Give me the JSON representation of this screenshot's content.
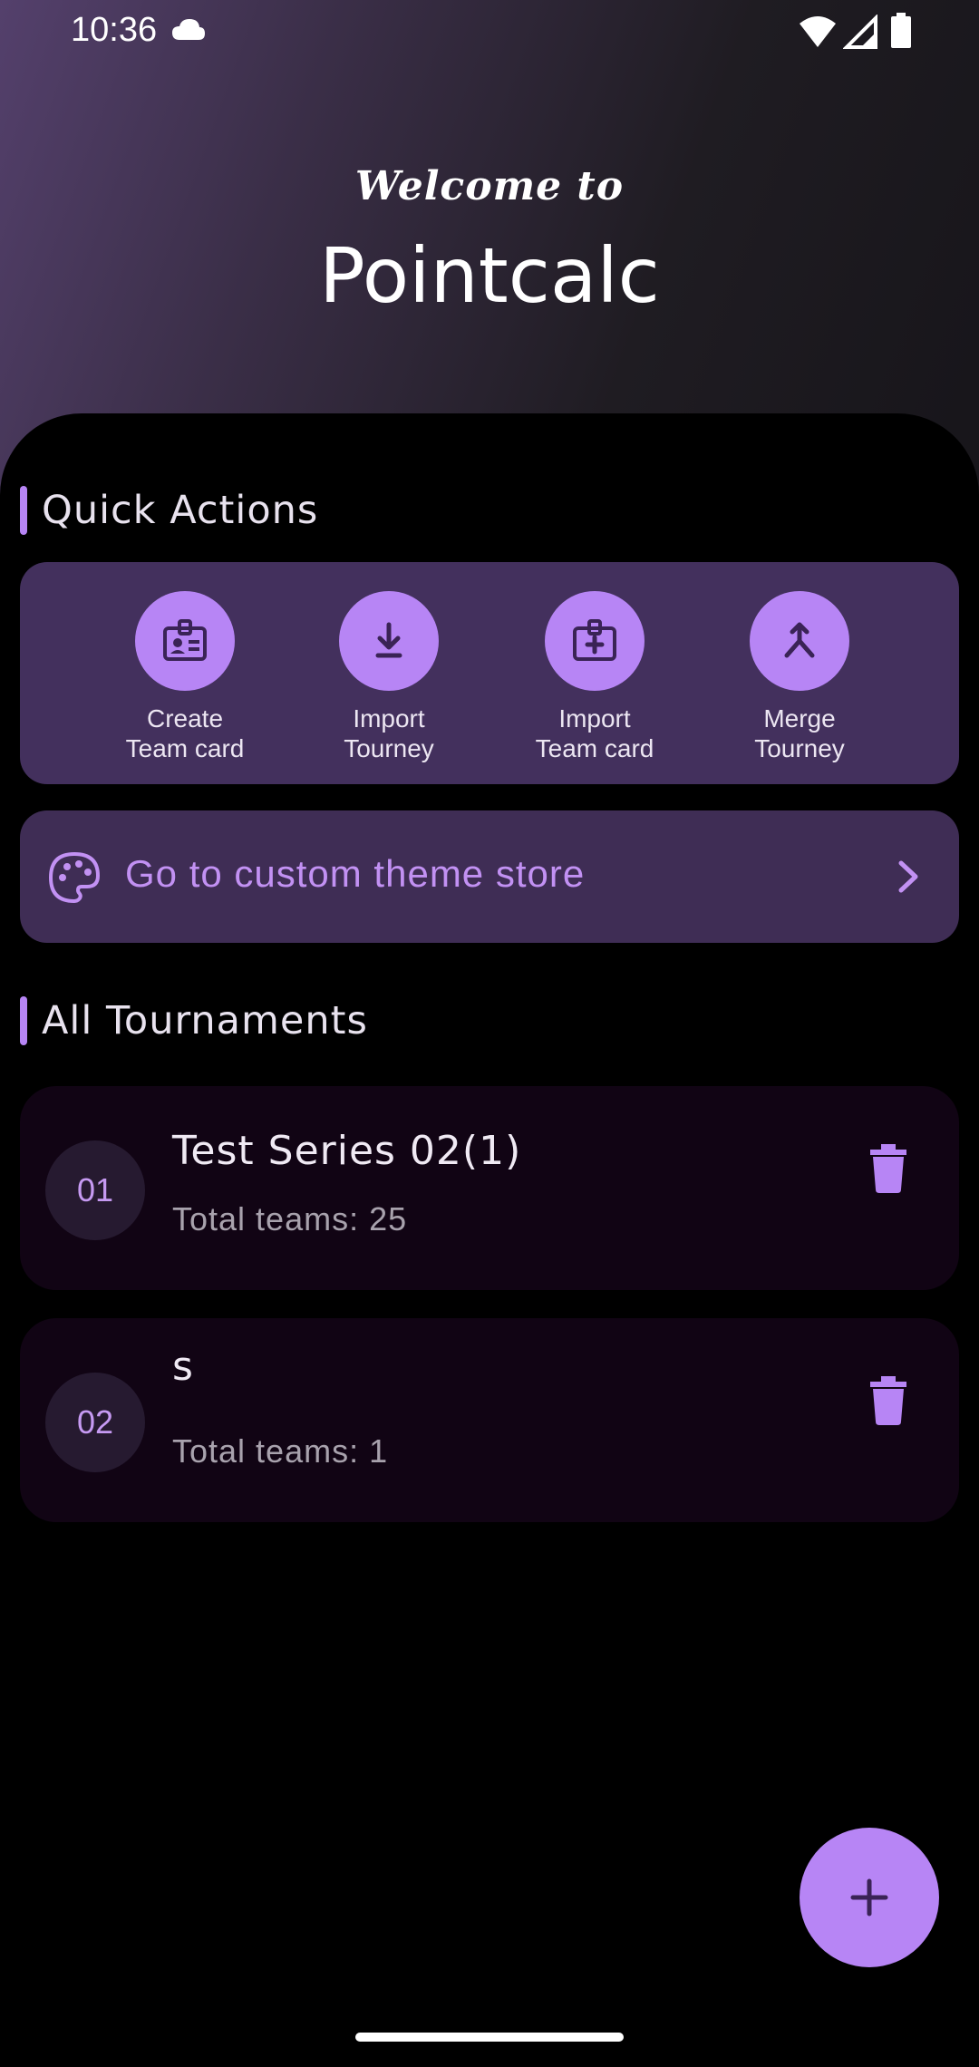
{
  "status_bar": {
    "time": "10:36"
  },
  "header": {
    "welcome": "Welcome to",
    "title": "Pointcalc"
  },
  "quick_actions": {
    "title": "Quick Actions",
    "items": [
      {
        "label": "Create\nTeam card",
        "icon": "badge-icon"
      },
      {
        "label": "Import\nTourney",
        "icon": "download-icon"
      },
      {
        "label": "Import\nTeam card",
        "icon": "badge-plus-icon"
      },
      {
        "label": "Merge\nTourney",
        "icon": "merge-icon"
      }
    ]
  },
  "theme_store": {
    "label": "Go to custom theme store"
  },
  "tournaments": {
    "title": "All Tournaments",
    "items": [
      {
        "number": "01",
        "name": "Test Series 02(1)",
        "teams": "Total teams: 25"
      },
      {
        "number": "02",
        "name": "s",
        "teams": "Total teams: 1"
      }
    ]
  },
  "colors": {
    "accent": "#b785f5",
    "card": "#43305d",
    "tournament_card": "#110414"
  }
}
